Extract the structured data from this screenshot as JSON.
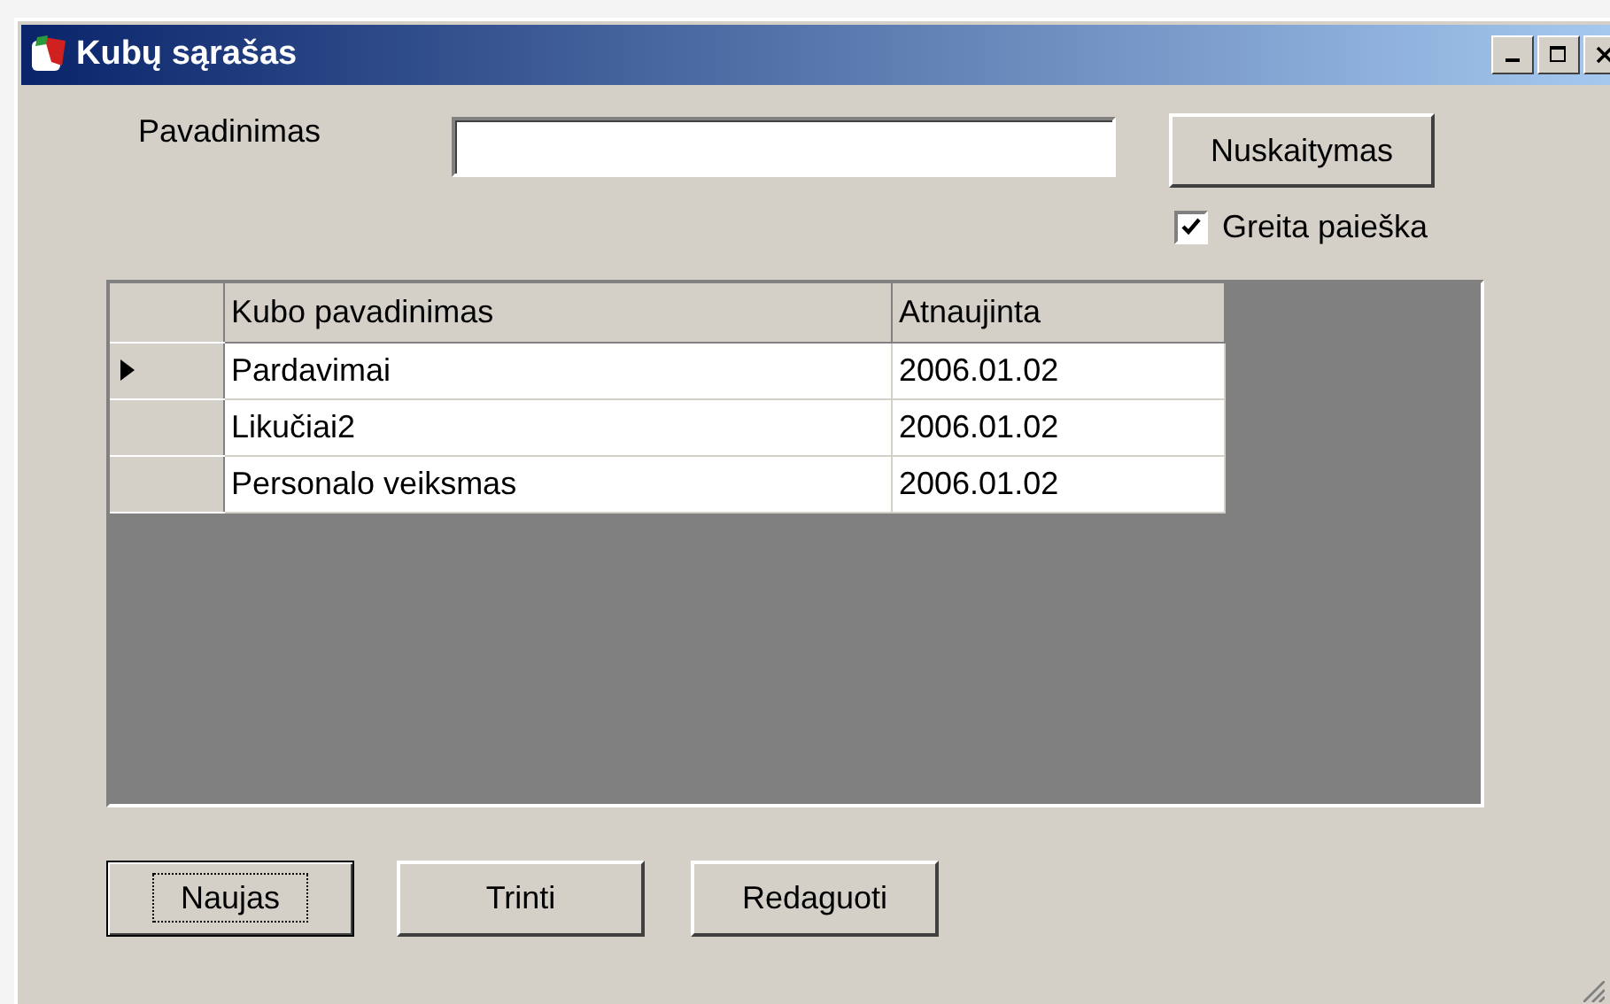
{
  "window": {
    "title": "Kubų sąrašas",
    "controls": [
      {
        "kind": "minimize"
      },
      {
        "kind": "maximize"
      },
      {
        "kind": "close"
      }
    ]
  },
  "search": {
    "label": "Pavadinimas",
    "button": "Nuskaitymas"
  },
  "quick_search": {
    "label": "Greita paieška",
    "checked": true
  },
  "table": {
    "columns": [
      "Kubo pavadinimas",
      "Atnaujinta"
    ],
    "rows": [
      {
        "cells": [
          "Pardavimai",
          "2006.01.02"
        ],
        "selected": true
      },
      {
        "cells": [
          "Likučiai2",
          "2006.01.02"
        ],
        "selected": false
      },
      {
        "cells": [
          "Personalo veiksmas",
          "2006.01.02"
        ],
        "selected": false
      }
    ]
  },
  "buttons": [
    {
      "label": "Naujas",
      "focused": true
    },
    {
      "label": "Trinti",
      "focused": false
    },
    {
      "label": "Redaguoti",
      "focused": false
    }
  ]
}
